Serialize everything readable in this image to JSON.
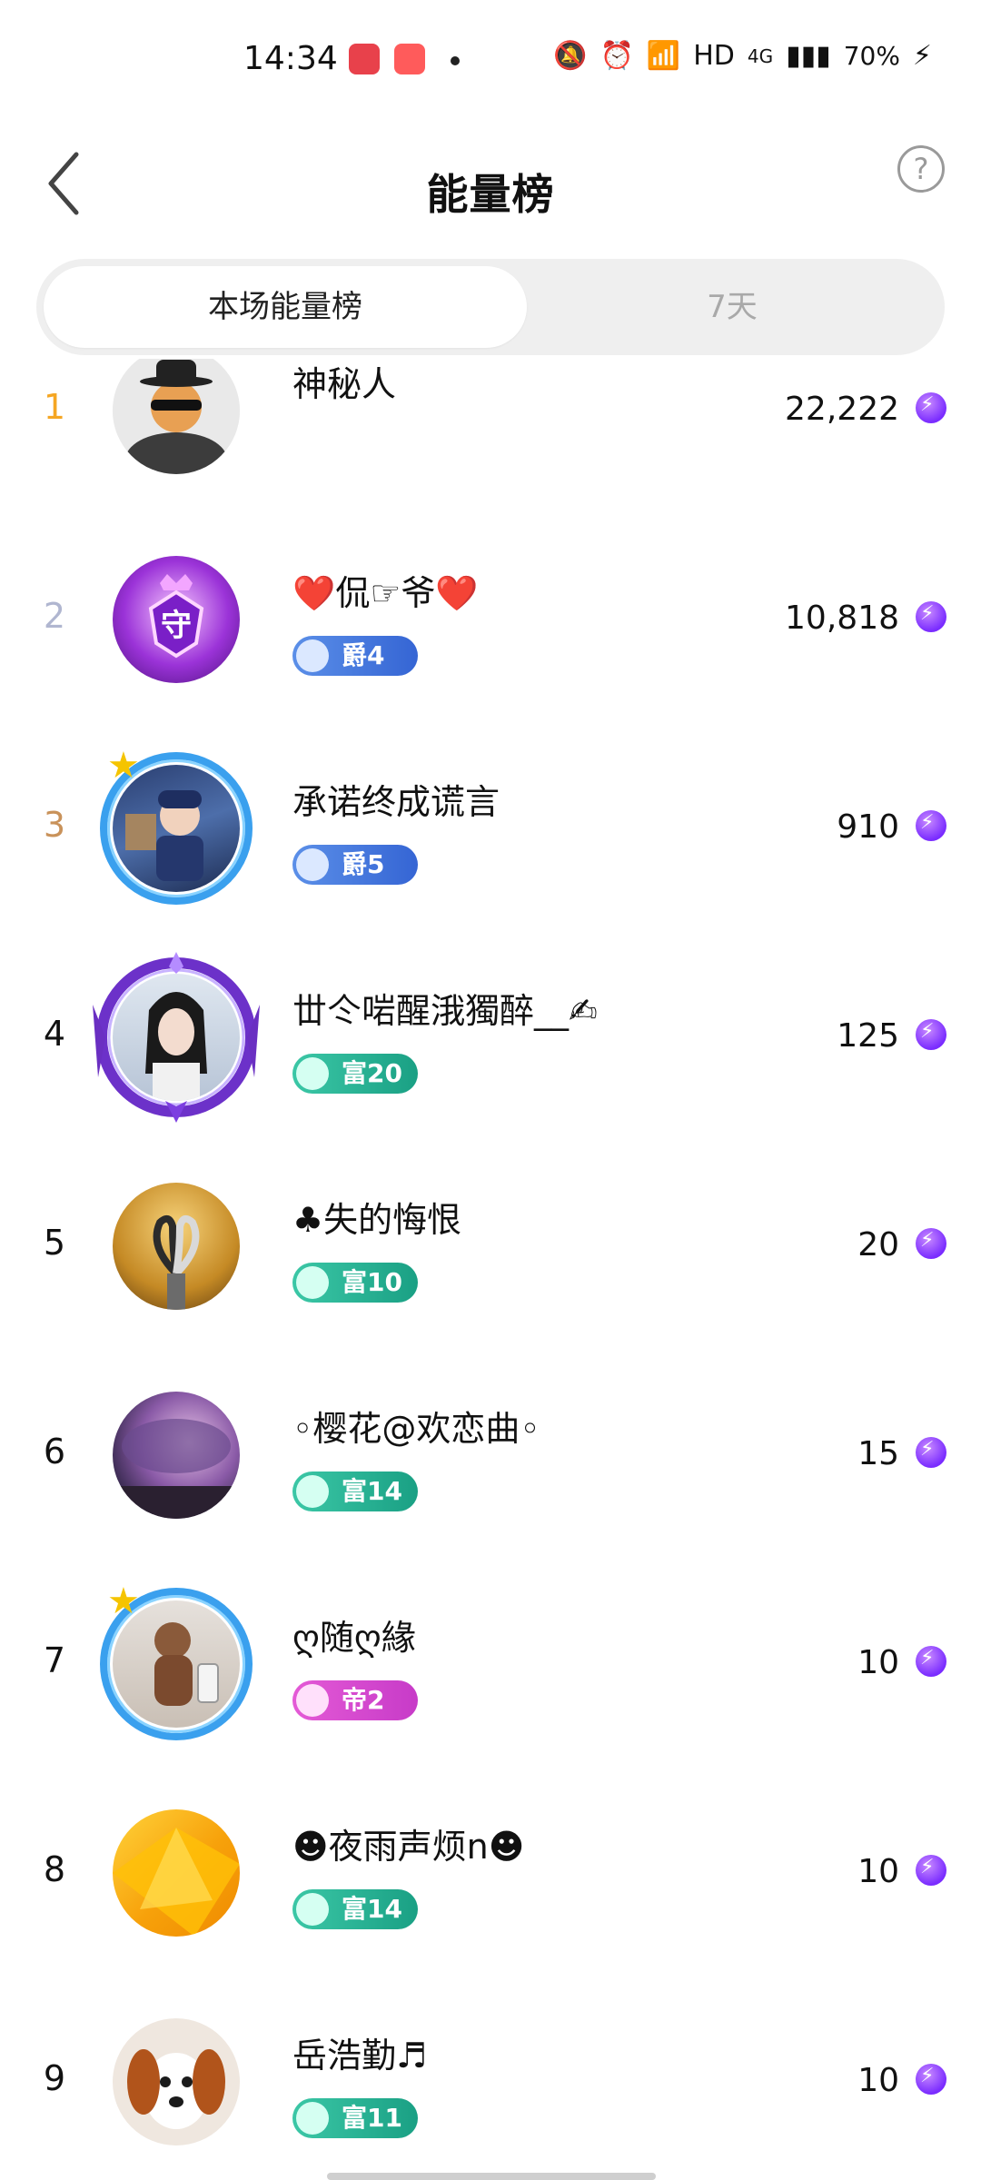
{
  "status": {
    "time": "14:34",
    "hd": "HD",
    "net": "4G",
    "battery": "70%"
  },
  "header": {
    "title": "能量榜",
    "help": "?"
  },
  "tabs": [
    {
      "label": "本场能量榜",
      "active": true
    },
    {
      "label": "7天",
      "active": false
    }
  ],
  "rows": [
    {
      "rank": "1",
      "name": "神秘人",
      "score": "22,222",
      "badge": null,
      "rank_color": "#f5a623"
    },
    {
      "rank": "2",
      "name": "❤️侃☞爷❤️",
      "score": "10,818",
      "badge": {
        "label": "爵4",
        "color": "blue"
      },
      "rank_color": "#b0b6d0"
    },
    {
      "rank": "3",
      "name": "承诺终成谎言",
      "score": "910",
      "badge": {
        "label": "爵5",
        "color": "blue"
      },
      "rank_color": "#c9925a"
    },
    {
      "rank": "4",
      "name": "丗仒啱醒涐獨醉__✍",
      "score": "125",
      "badge": {
        "label": "富20",
        "color": "green"
      },
      "rank_color": "#111111"
    },
    {
      "rank": "5",
      "name": "♣失的悔恨",
      "score": "20",
      "badge": {
        "label": "富10",
        "color": "green"
      },
      "rank_color": "#111111"
    },
    {
      "rank": "6",
      "name": "◦樱花@欢恋曲◦",
      "score": "15",
      "badge": {
        "label": "富14",
        "color": "green"
      },
      "rank_color": "#111111"
    },
    {
      "rank": "7",
      "name": "ღ随ღ緣",
      "score": "10",
      "badge": {
        "label": "帝2",
        "color": "pink"
      },
      "rank_color": "#111111"
    },
    {
      "rank": "8",
      "name": "☻夜雨声烦n☻",
      "score": "10",
      "badge": {
        "label": "富14",
        "color": "green"
      },
      "rank_color": "#111111"
    },
    {
      "rank": "9",
      "name": "岳浩勤♬",
      "score": "10",
      "badge": {
        "label": "富11",
        "color": "green"
      },
      "rank_color": "#111111"
    }
  ]
}
